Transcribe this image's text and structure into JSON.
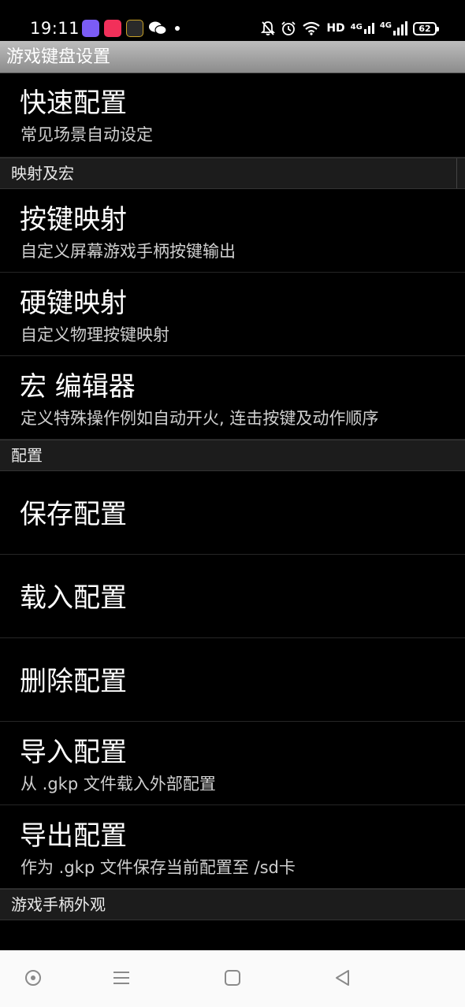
{
  "status_bar": {
    "time": "19:11",
    "apps": [
      {
        "name": "app-icon-1",
        "color": "#7b5cf5"
      },
      {
        "name": "app-icon-2",
        "color": "#f2305a"
      },
      {
        "name": "app-icon-3",
        "color": "#2a2a2a"
      },
      {
        "name": "wechat-icon",
        "color": "#ffffff"
      }
    ],
    "network": "HD",
    "signal_1": "4G",
    "signal_2": "4G",
    "battery": "62"
  },
  "title": "游戏键盘设置",
  "sections": [
    {
      "header": null,
      "items": [
        {
          "title": "快速配置",
          "subtitle": "常见场景自动设定"
        }
      ]
    },
    {
      "header": "映射及宏",
      "items": [
        {
          "title": "按键映射",
          "subtitle": "自定义屏幕游戏手柄按键输出"
        },
        {
          "title": "硬键映射",
          "subtitle": "自定义物理按键映射"
        },
        {
          "title": "宏 编辑器",
          "subtitle": "定义特殊操作例如自动开火, 连击按键及动作顺序"
        }
      ]
    },
    {
      "header": "配置",
      "items": [
        {
          "title": "保存配置",
          "subtitle": ""
        },
        {
          "title": "载入配置",
          "subtitle": ""
        },
        {
          "title": "删除配置",
          "subtitle": ""
        },
        {
          "title": "导入配置",
          "subtitle": "从 .gkp 文件载入外部配置"
        },
        {
          "title": "导出配置",
          "subtitle": "作为 .gkp 文件保存当前配置至 /sd卡"
        }
      ]
    },
    {
      "header": "游戏手柄外观",
      "items": []
    }
  ],
  "nav_bar": [
    "home-circle-icon",
    "menu-icon",
    "square-icon",
    "back-icon"
  ]
}
